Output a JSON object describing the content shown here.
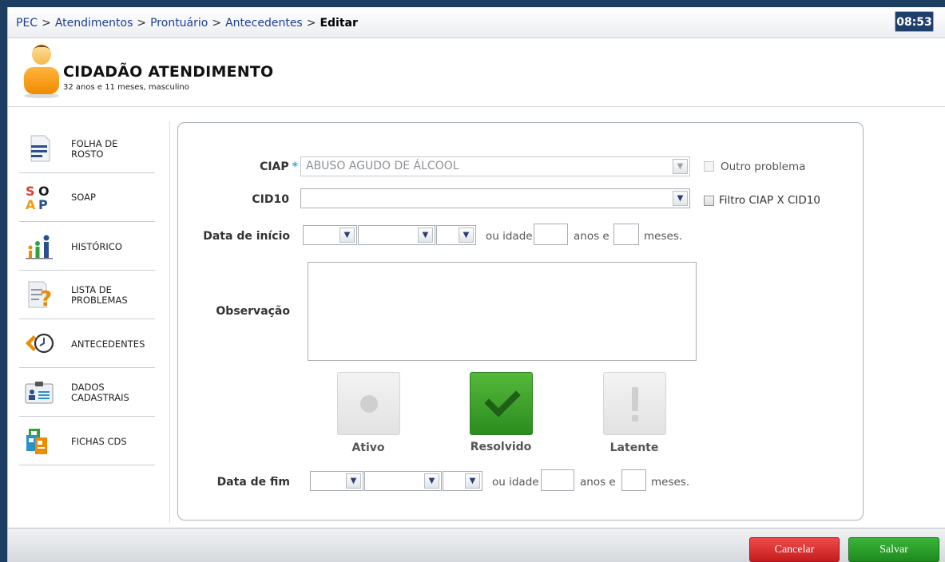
{
  "breadcrumb": {
    "items": [
      "PEC",
      "Atendimentos",
      "Prontuário",
      "Antecedentes"
    ],
    "separator": ">",
    "current": "Editar"
  },
  "clock": "08:53",
  "patient": {
    "name": "CIDADÃO ATENDIMENTO",
    "info": "32 anos e 11 meses, masculino"
  },
  "sidebar": {
    "items": [
      {
        "line1": "FOLHA DE",
        "line2": "ROSTO",
        "icon": "document-icon"
      },
      {
        "line1": "SOAP",
        "line2": "",
        "icon": "soap-icon"
      },
      {
        "line1": "HISTÓRICO",
        "line2": "",
        "icon": "history-people-icon"
      },
      {
        "line1": "LISTA DE",
        "line2": "PROBLEMAS",
        "icon": "problem-list-icon"
      },
      {
        "line1": "ANTECEDENTES",
        "line2": "",
        "icon": "clock-back-icon"
      },
      {
        "line1": "DADOS",
        "line2": "CADASTRAIS",
        "icon": "id-card-icon"
      },
      {
        "line1": "FICHAS CDS",
        "line2": "",
        "icon": "forms-icon"
      }
    ]
  },
  "form": {
    "ciap_label": "CIAP",
    "ciap_required": "*",
    "ciap_value": "ABUSO AGUDO DE ÁLCOOL",
    "outro_problema": "Outro problema",
    "cid10_label": "CID10",
    "cid10_value": "",
    "filtro": "Filtro CIAP X CID10",
    "data_inicio_label": "Data de início",
    "ou_idade": "ou idade",
    "anos_e": "anos e",
    "meses": "meses.",
    "observacao_label": "Observação",
    "status": {
      "ativo": "Ativo",
      "resolvido": "Resolvido",
      "latente": "Latente",
      "selected": "Resolvido"
    },
    "data_fim_label": "Data de fim"
  },
  "footer": {
    "cancel": "Cancelar",
    "save": "Salvar"
  },
  "colors": {
    "accent_green": "#2b8d1f",
    "cancel_red": "#c51d1d",
    "frame_blue": "#1c3f61"
  }
}
